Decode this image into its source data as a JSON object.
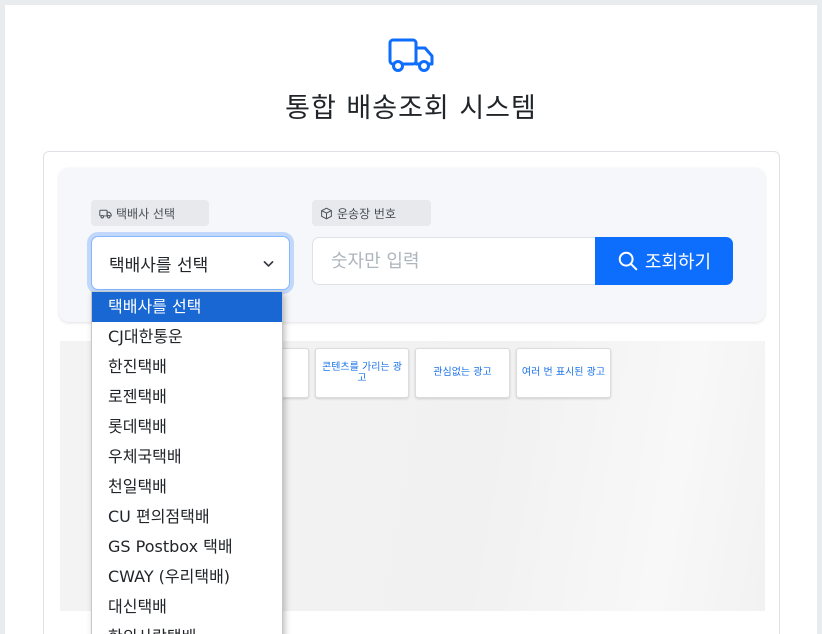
{
  "header": {
    "icon": "truck-icon",
    "title": "통합 배송조회 시스템"
  },
  "search": {
    "carrier_label": "택배사 선택",
    "carrier_label_icon": "truck-icon",
    "tracking_label": "운송장 번호",
    "tracking_label_icon": "box-icon",
    "carrier_selected": "택배사를 선택",
    "tracking_placeholder": "숫자만 입력",
    "tracking_value": "",
    "submit_label": "조회하기",
    "submit_icon": "search-icon"
  },
  "ads": {
    "buttons": [
      "",
      "콘텐츠를 가리는 광고",
      "관심없는 광고",
      "여러 번 표시된 광고"
    ]
  },
  "dropdown": {
    "options": [
      "택배사를 선택",
      "CJ대한통운",
      "한진택배",
      "로젠택배",
      "롯데택배",
      "우체국택배",
      "천일택배",
      "CU 편의점택배",
      "GS Postbox 택배",
      "CWAY (우리택배)",
      "대신택배",
      "한의사랑택배"
    ],
    "selected_index": 0
  },
  "colors": {
    "accent": "#0d6efd",
    "selected_option": "#1967d2",
    "ad_link": "#1a73e8"
  }
}
